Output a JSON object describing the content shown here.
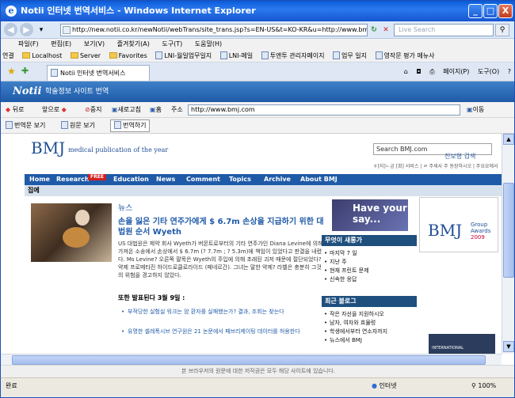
{
  "window": {
    "title": "Notii 인터넷 번역서비스 - Windows Internet Explorer",
    "min": "_",
    "max": "□",
    "close": "X"
  },
  "address_bar": {
    "url": "http://new.notii.co.kr/newNotii/webTrans/site_trans.jsp?s=EN-US&t=KO-KR&u=http://www.bmj.com",
    "search_placeholder": "Live Search"
  },
  "menu": [
    "파일(F)",
    "편집(E)",
    "보기(V)",
    "즐겨찾기(A)",
    "도구(T)",
    "도움말(H)"
  ],
  "links_bar": {
    "label": "연결",
    "items": [
      "Localhost",
      "Server",
      "Favorites",
      "LNI-월일업무일지",
      "LNI-메일",
      "투앤투 관리자페이지",
      "업무 일지",
      "영작문 평가 메뉴사"
    ]
  },
  "tab": {
    "label": "Notii 인터넷 번역서비스",
    "tools": [
      "페이지(P)",
      "도구(O)"
    ]
  },
  "notii": {
    "logo": "Notii",
    "subtitle": "학술정보 사이트 번역"
  },
  "translator_toolbar": {
    "back": "뒤로",
    "forward": "앞으로",
    "stop": "중지",
    "refresh": "새로고침",
    "home": "홈",
    "address_label": "주소",
    "url": "http://www.bmj.com",
    "go": "이동",
    "view_translation": "번역문 보기",
    "view_original": "원문 보기",
    "translate": "번역하기"
  },
  "bmj": {
    "logo": "BMJ",
    "tagline": "medical publication of the year",
    "search_placeholder": "Search BMJ.com",
    "advanced_search": "진보형 검색",
    "small_links": "ㅎ[지]ㄴ금 [회] 서비스 | ㄹ 주세사 주 동장하시오 | 주요요에서",
    "nav": [
      "Home",
      "Research",
      "Education",
      "News",
      "Comment",
      "Topics",
      "Archive",
      "About BMJ"
    ],
    "free_badge": "FREE",
    "breadcrumb": "집에",
    "news_label": "뉴스",
    "headline": "손을 잃은 기타 연주가에게 $ 6.7m 손상을 지급하기 위한 대법원 순서 Wyeth",
    "body": "US 대법원은 제약 회사 Wyeth가 버몬트로부터의 기타 연주가인 Diana Levine에 의해 가져온 소송에서 손상에서 $ 6.7m (? 7.7m ; ? 5.3m)에 책임이 있었다고 판결을 내렸다. Ms Levine? 오른쪽 팔목은 Wyeth의 주입에 의해 초래된 괴저 때문에 절단되었다? 약제 프로메타진 하이드로클로라이드 (페네르간). 그녀는 말한 약제? 라벨은 충분히 그것의 위험을 경고하지 않았다.",
    "also_label": "또한 발표된다 3월 9일 :",
    "bullets": [
      "부적당한 실험실 워크는 암 환자를 실패했는가? 결과, 조회는 찾는다",
      "유명한 셀레폭시브 연구원은 21 논문에서 패브리케이팅 데이터를 허용한다"
    ],
    "have_your_say": "Have your say...",
    "whats_new_title": "무엇이 새롱가",
    "whats_new": [
      "마지막 7 일",
      "지난 주",
      "현재 프린트 문제",
      "신속한 응답"
    ],
    "blogs_title": "최근 블로그",
    "blogs": [
      "작은 자선을 지원하시오",
      "남자, 여자와 흐물렁",
      "학생에서부터 연소자까지",
      "뉴스에서 BMJ"
    ],
    "ad_logo": "BMJ",
    "ad_group": "Group",
    "ad_awards": "Awards",
    "ad_year": "2009",
    "ad2": "INTERNATIONAL"
  },
  "notice": "본 브라우저의 원문에 대한 저작권은 모두 해당 사이트에 있습니다.",
  "status": {
    "left": "완료",
    "zone": "인터넷",
    "zoom": "100%"
  }
}
